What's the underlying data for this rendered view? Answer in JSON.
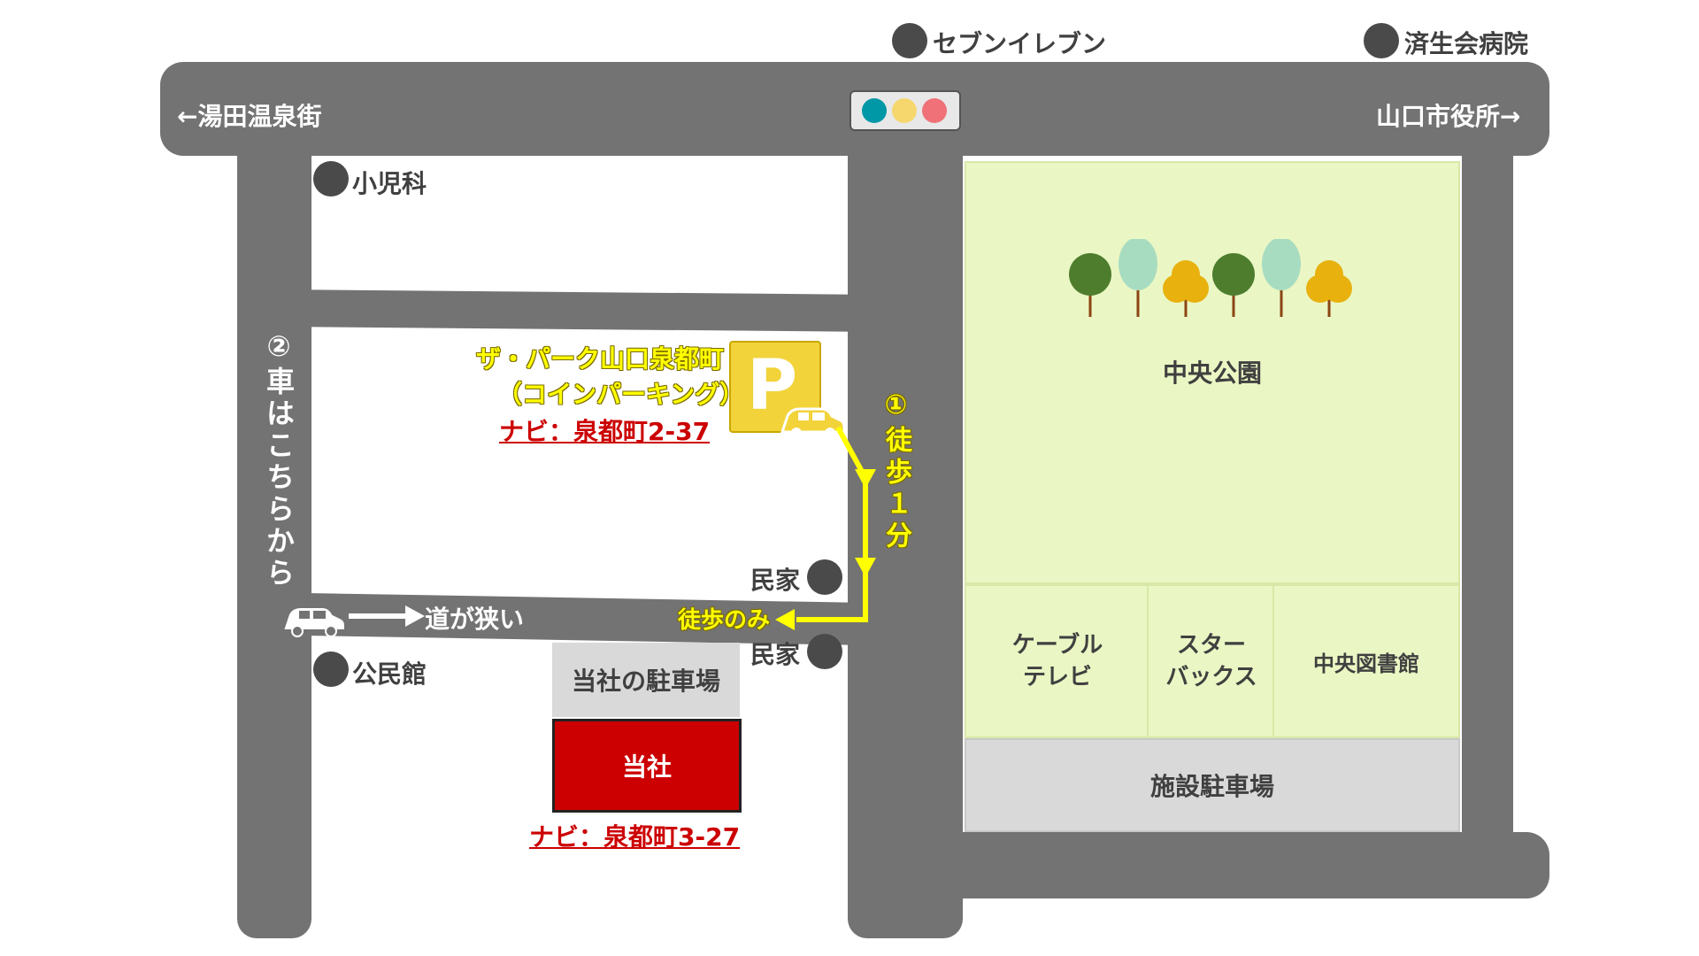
{
  "poi": {
    "seven_eleven": "セブンイレブン",
    "saiseikai_hospital": "済生会病院",
    "pediatrics": "小児科",
    "private_house_1": "民家",
    "private_house_2": "民家",
    "community_hall": "公民館"
  },
  "roads": {
    "yuda_onsen": "←湯田温泉街",
    "city_hall": "山口市役所→",
    "car_route": "②車はこちらから",
    "narrow_road": "道が狭い"
  },
  "parking": {
    "name": "ザ・パーク山口泉都町",
    "type": "（コインパーキング）",
    "navi": "ナビ：泉都町2-37",
    "sign": "P"
  },
  "walk": {
    "route_label": "①徒歩１分",
    "walk_only": "徒歩のみ"
  },
  "company": {
    "parking": "当社の駐車場",
    "name": "当社",
    "navi": "ナビ：泉都町3-27"
  },
  "park_area": {
    "park": "中央公園",
    "cable_tv": [
      "ケーブル",
      "テレビ"
    ],
    "starbucks": [
      "スター",
      "バックス"
    ],
    "library": "中央図書館",
    "facility_parking": "施設駐車場"
  },
  "colors": {
    "road": "#737373",
    "park": "#eaf7c4",
    "company": "#cc0000",
    "walk_route": "#ffff00",
    "parking_sign": "#f2d33a"
  },
  "traffic_light": [
    "#0097a7",
    "#f5d76e",
    "#f07178"
  ]
}
